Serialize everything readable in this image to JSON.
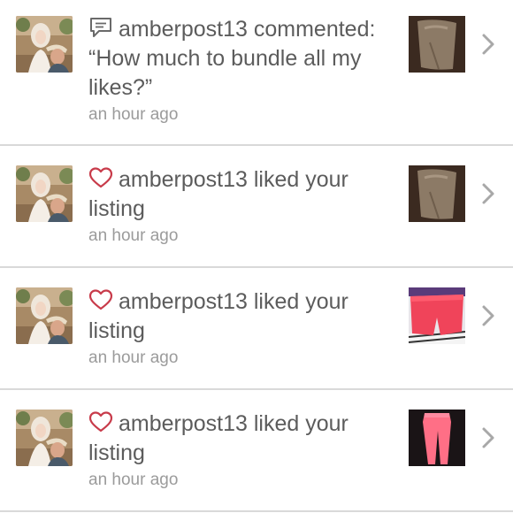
{
  "notifications": [
    {
      "type_icon": "comment-icon",
      "message": "amberpost13 commented: “How much to bundle all my likes?”",
      "time": "an hour ago",
      "thumbnail": "taupe-item-thumbnail"
    },
    {
      "type_icon": "heart-icon",
      "message": "amberpost13 liked your listing",
      "time": "an hour ago",
      "thumbnail": "taupe-item-thumbnail"
    },
    {
      "type_icon": "heart-icon",
      "message": "amberpost13 liked your listing",
      "time": "an hour ago",
      "thumbnail": "coral-shorts-thumbnail"
    },
    {
      "type_icon": "heart-icon",
      "message": "amberpost13 liked your listing",
      "time": "an hour ago",
      "thumbnail": "pink-leggings-thumbnail"
    }
  ],
  "colors": {
    "text": "#5c5c5c",
    "muted": "#9b9b9b",
    "heart": "#c83b4a",
    "divider": "#d9d9d9",
    "chevron": "#a8a8a8"
  }
}
